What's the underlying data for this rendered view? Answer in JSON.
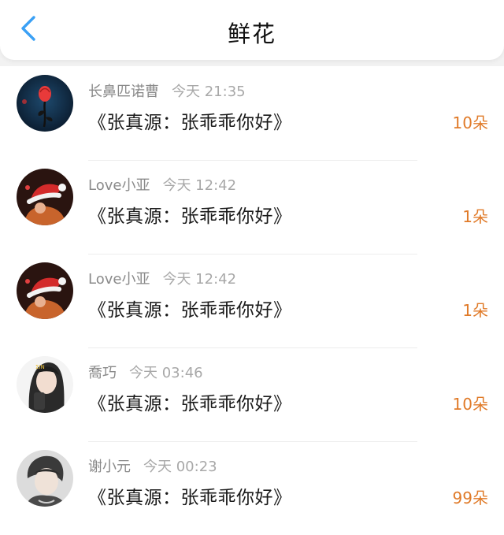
{
  "header": {
    "title": "鲜花",
    "back_icon": "chevron-left-icon",
    "accent_color": "#3aa0f5"
  },
  "rows": [
    {
      "name": "长鼻匹诺曹",
      "time": "今天 21:35",
      "message": "《张真源：张乖乖你好》",
      "count": "10朵",
      "avatar": "rose-avatar"
    },
    {
      "name": "Love小亚",
      "time": "今天 12:42",
      "message": "《张真源：张乖乖你好》",
      "count": "1朵",
      "avatar": "santa-hat-avatar"
    },
    {
      "name": "Love小亚",
      "time": "今天 12:42",
      "message": "《张真源：张乖乖你好》",
      "count": "1朵",
      "avatar": "santa-hat-avatar"
    },
    {
      "name": "喬巧",
      "time": "今天 03:46",
      "message": "《张真源：张乖乖你好》",
      "count": "10朵",
      "avatar": "girl-avatar"
    },
    {
      "name": "谢小元",
      "time": "今天 00:23",
      "message": "《张真源：张乖乖你好》",
      "count": "99朵",
      "avatar": "boy-avatar"
    }
  ],
  "colors": {
    "count": "#e07a28",
    "meta": "#8a8a8a"
  }
}
